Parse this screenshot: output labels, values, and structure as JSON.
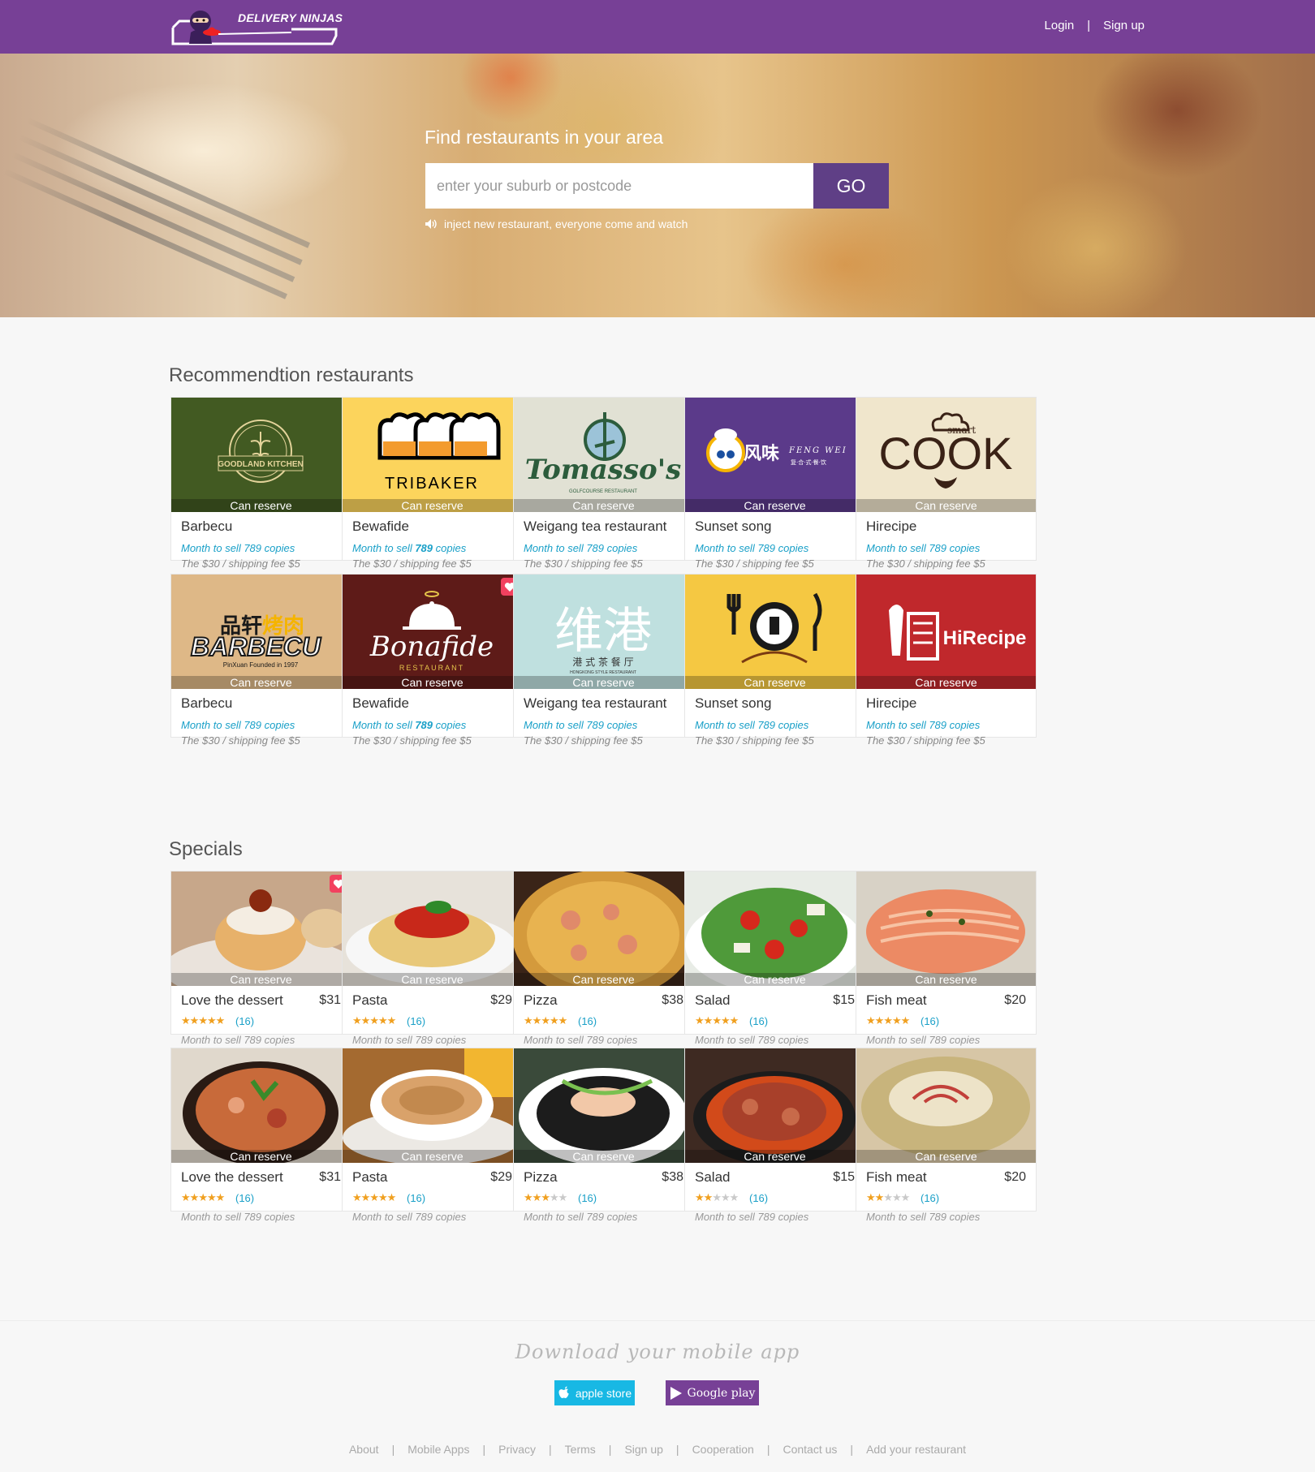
{
  "brand": {
    "name": "DELIVERY NINJAS",
    "accent": "#774096"
  },
  "header": {
    "login": "Login",
    "separator": "|",
    "signup": "Sign up"
  },
  "hero": {
    "title": "Find restaurants in your area",
    "search_placeholder": "enter your suburb or postcode",
    "go_label": "GO",
    "notice": "inject new restaurant, everyone come and watch",
    "notice_icon": "speaker-icon"
  },
  "recommendations": {
    "title": "Recommendtion restaurants",
    "badge": "Can reserve",
    "items": [
      {
        "name": "Barbecu",
        "sell_pre": "Month to sell ",
        "sell_num": "789",
        "sell_post": " copies",
        "fee": "The $30 / shipping fee $5",
        "logo": "GOODLAND KITCHEN",
        "bg": "#425a22"
      },
      {
        "name": "Bewafide",
        "sell_pre": "Month to sell ",
        "sell_num": "789",
        "sell_post": " copies",
        "fee": "The $30 / shipping fee $5",
        "logo": "TRIBAKER",
        "bg": "#fcd45c",
        "num_bold": true
      },
      {
        "name": "Weigang tea restaurant",
        "sell_pre": "Month to sell ",
        "sell_num": "789",
        "sell_post": " copies",
        "fee": "The $30 / shipping fee $5",
        "logo": "Tomasso's",
        "sublogo": "GOLFCOURSE   RESTAURANT",
        "bg": "#e1e1d4"
      },
      {
        "name": "Sunset song",
        "sell_pre": "Month to sell ",
        "sell_num": "789",
        "sell_post": " copies",
        "fee": "The $30 / shipping fee $5",
        "logo": "风味 FENG WEI",
        "sublogo": "复合式餐饮",
        "bg": "#5b3a8a"
      },
      {
        "name": "Hirecipe",
        "sell_pre": "Month to sell ",
        "sell_num": "789",
        "sell_post": " copies",
        "fee": "The $30 / shipping fee $5",
        "logo": "COOK",
        "sublogo": "smart",
        "bg": "#f0e6cc"
      },
      {
        "name": "Barbecu",
        "sell_pre": "Month to sell ",
        "sell_num": "789",
        "sell_post": " copies",
        "fee": "The $30 / shipping fee $5",
        "logo": "BARBECU",
        "sublogo": "PinXuan Founded in 1997",
        "extra": "品轩烤肉",
        "bg": "#deb887"
      },
      {
        "name": "Bewafide",
        "sell_pre": "Month to sell ",
        "sell_num": "789",
        "sell_post": " copies",
        "fee": "The $30 / shipping fee $5",
        "logo": "Bonafide",
        "sublogo": "RESTAURANT",
        "bg": "#5e1b18",
        "favorite": true,
        "num_bold": true
      },
      {
        "name": "Weigang tea restaurant",
        "sell_pre": "Month to sell ",
        "sell_num": "789",
        "sell_post": " copies",
        "fee": "The $30 / shipping fee $5",
        "logo": "维港",
        "sublogo": "港式茶餐厅",
        "extra": "HONGKONG STYLE RESTAURANT",
        "bg": "#bfe0df"
      },
      {
        "name": "Sunset song",
        "sell_pre": "Month to sell ",
        "sell_num": "789",
        "sell_post": " copies",
        "fee": "The $30 / shipping fee $5",
        "logo": "fork-knife-logo",
        "bg": "#f5c842"
      },
      {
        "name": "Hirecipe",
        "sell_pre": "Month to sell ",
        "sell_num": "789",
        "sell_post": " copies",
        "fee": "The $30 / shipping fee $5",
        "logo": "HiRecipe",
        "bg": "#c0282c"
      }
    ]
  },
  "specials": {
    "title": "Specials",
    "badge": "Can reserve",
    "items": [
      {
        "name": "Love the dessert",
        "price": "$31",
        "rating": 5,
        "count": "(16)",
        "sold": "Month to sell 789 copies",
        "favorite": true
      },
      {
        "name": "Pasta",
        "price": "$29",
        "rating": 5,
        "count": "(16)",
        "sold": "Month to sell 789 copies"
      },
      {
        "name": "Pizza",
        "price": "$38",
        "rating": 5,
        "count": "(16)",
        "sold": "Month to sell 789 copies"
      },
      {
        "name": "Salad",
        "price": "$15",
        "rating": 5,
        "count": "(16)",
        "sold": "Month to sell 789 copies"
      },
      {
        "name": "Fish meat",
        "price": "$20",
        "rating": 5,
        "count": "(16)",
        "sold": "Month to sell 789 copies"
      },
      {
        "name": "Love the dessert",
        "price": "$31",
        "rating": 5,
        "count": "(16)",
        "sold": "Month to sell 789 copies"
      },
      {
        "name": "Pasta",
        "price": "$29",
        "rating": 4.5,
        "count": "(16)",
        "sold": "Month to sell 789 copies"
      },
      {
        "name": "Pizza",
        "price": "$38",
        "rating": 3,
        "count": "(16)",
        "sold": "Month to sell 789 copies"
      },
      {
        "name": "Salad",
        "price": "$15",
        "rating": 2,
        "count": "(16)",
        "sold": "Month to sell 789 copies"
      },
      {
        "name": "Fish meat",
        "price": "$20",
        "rating": 2,
        "count": "(16)",
        "sold": "Month to sell 789 copies"
      }
    ]
  },
  "apps": {
    "title": "Download your mobile app",
    "apple": "apple store",
    "google": "Google play"
  },
  "footer": {
    "links": [
      "About",
      "Mobile Apps",
      "Privacy",
      "Terms",
      "Sign up",
      "Cooperation",
      "Contact us",
      "Add your restaurant"
    ],
    "separator": "|"
  }
}
